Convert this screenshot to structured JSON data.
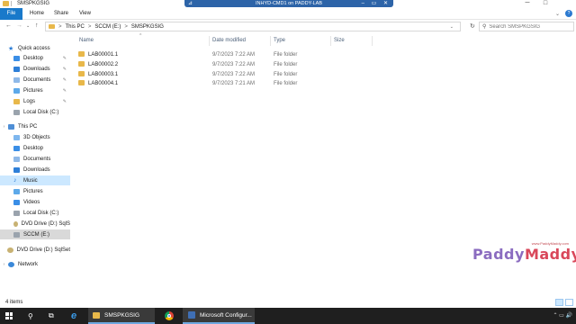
{
  "window": {
    "title": "SMSPKGSIG",
    "controls": {
      "minimize": "─",
      "maximize": "□"
    }
  },
  "rdp_bar": {
    "title": "INHYD-CMD1 on PADDY-LAB",
    "pin": "⊿",
    "right": "– ▭ ✕"
  },
  "ribbon": {
    "tabs": [
      "File",
      "Home",
      "Share",
      "View"
    ],
    "expand": "⌄",
    "help": "?"
  },
  "address": {
    "back": "←",
    "forward": "→",
    "recent": "⌄",
    "up": "↑",
    "crumbs": [
      "This PC",
      "SCCM (E:)",
      "SMSPKGSIG"
    ],
    "sep": ">",
    "dropdown": "⌄",
    "refresh": "↻",
    "search_placeholder": "Search SMSPKGSIG",
    "search_icon": "⚲"
  },
  "sidebar": {
    "items": [
      {
        "label": "Quick access",
        "icon": "star-icon",
        "pinned": false
      },
      {
        "label": "Desktop",
        "icon": "desktop-icon",
        "pinned": true
      },
      {
        "label": "Downloads",
        "icon": "downloads-icon",
        "pinned": true
      },
      {
        "label": "Documents",
        "icon": "documents-icon",
        "pinned": true
      },
      {
        "label": "Pictures",
        "icon": "pictures-icon",
        "pinned": true
      },
      {
        "label": "Logs",
        "icon": "folder-icon",
        "pinned": true
      },
      {
        "label": "Local Disk (C:)",
        "icon": "disk-icon",
        "pinned": false
      },
      {
        "label": "This PC",
        "icon": "pc-icon",
        "pinned": false
      },
      {
        "label": "3D Objects",
        "icon": "3d-objects-icon",
        "pinned": false
      },
      {
        "label": "Desktop",
        "icon": "desktop-icon",
        "pinned": false
      },
      {
        "label": "Documents",
        "icon": "documents-icon",
        "pinned": false
      },
      {
        "label": "Downloads",
        "icon": "downloads-icon",
        "pinned": false
      },
      {
        "label": "Music",
        "icon": "music-icon",
        "pinned": false
      },
      {
        "label": "Pictures",
        "icon": "pictures-icon",
        "pinned": false
      },
      {
        "label": "Videos",
        "icon": "videos-icon",
        "pinned": false
      },
      {
        "label": "Local Disk (C:)",
        "icon": "disk-icon",
        "pinned": false
      },
      {
        "label": "DVD Drive (D:) SqlS",
        "icon": "dvd-icon",
        "pinned": false
      },
      {
        "label": "SCCM (E:)",
        "icon": "disk-icon",
        "pinned": false
      },
      {
        "label": "DVD Drive (D:) SqlSet",
        "icon": "dvd-icon",
        "pinned": false
      },
      {
        "label": "Network",
        "icon": "network-icon",
        "pinned": false
      }
    ],
    "pin_glyph": "✎",
    "expander": "›"
  },
  "columns": {
    "name": "Name",
    "date": "Date modified",
    "type": "Type",
    "size": "Size",
    "sort": "^"
  },
  "files": [
    {
      "name": "LAB00001.1",
      "date": "9/7/2023 7:22 AM",
      "type": "File folder",
      "size": ""
    },
    {
      "name": "LAB00002.2",
      "date": "9/7/2023 7:22 AM",
      "type": "File folder",
      "size": ""
    },
    {
      "name": "LAB00003.1",
      "date": "9/7/2023 7:22 AM",
      "type": "File folder",
      "size": ""
    },
    {
      "name": "LAB00004.1",
      "date": "9/7/2023 7:21 AM",
      "type": "File folder",
      "size": ""
    }
  ],
  "status": {
    "count": "4 items"
  },
  "watermark": {
    "url": "www.PaddyMaddy.com",
    "word1": "Paddy",
    "word2": "Maddy"
  },
  "taskbar": {
    "search": "⚲",
    "taskview": "⧉",
    "items": [
      {
        "label": "SMSPKGSIG"
      },
      {
        "label": "Microsoft Configur..."
      }
    ],
    "ie": "e",
    "tray": "⌃ ▭ 🔊"
  },
  "colors": {
    "accent": "#1979ca",
    "folder": "#e8b84a",
    "selected": "#cce8ff"
  }
}
